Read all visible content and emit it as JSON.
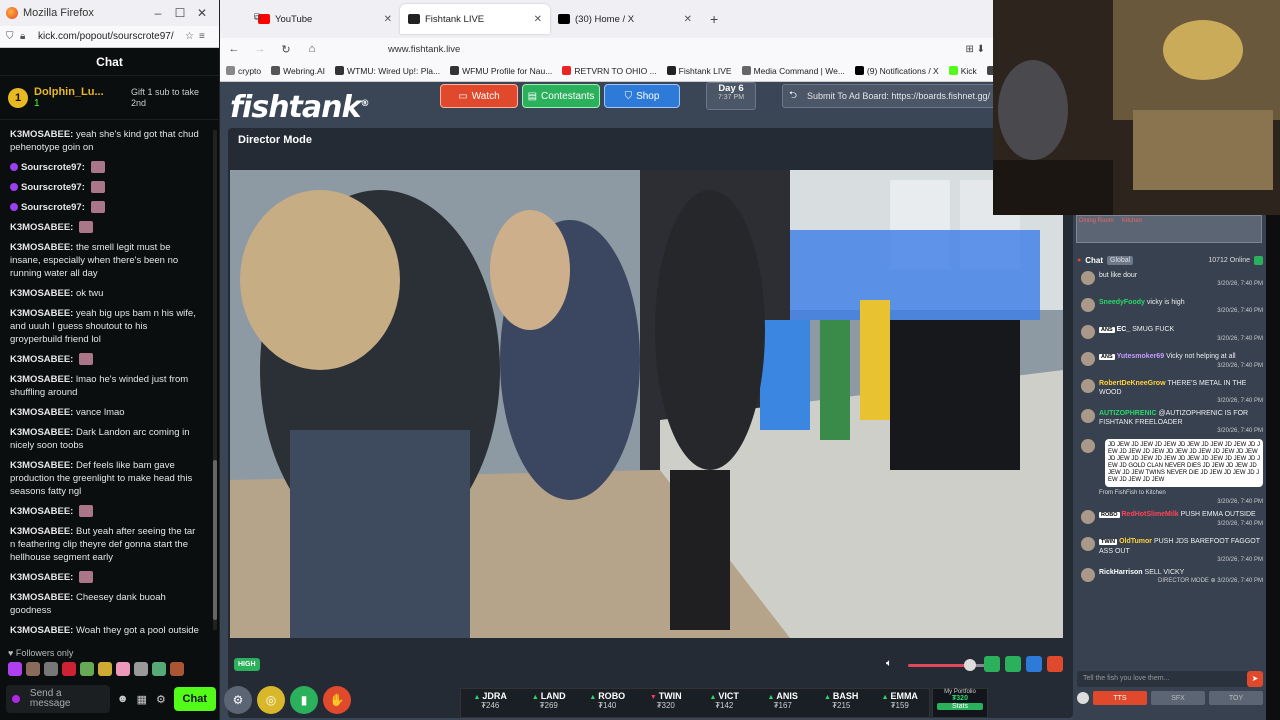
{
  "kick": {
    "window_title": "Mozilla Firefox",
    "url": "kick.com/popout/sourscrote97/",
    "chat_header": "Chat",
    "pinned": {
      "name": "Dolphin_Lu...",
      "count": "1",
      "gift_text": "Gift 1 sub to take 2nd"
    },
    "messages": [
      {
        "user": "K3MOSABEE:",
        "text": "yeah she's kind got that chud pehenotype goin on"
      },
      {
        "user": "Sourscrote97:",
        "text": "",
        "emote": true,
        "badge": true
      },
      {
        "user": "Sourscrote97:",
        "text": "",
        "emote": true,
        "badge": true
      },
      {
        "user": "Sourscrote97:",
        "text": "",
        "emote": true,
        "badge": true
      },
      {
        "user": "K3MOSABEE:",
        "text": "",
        "emote": true
      },
      {
        "user": "K3MOSABEE:",
        "text": "the smell legit must be insane, especially when there's been no running water all day"
      },
      {
        "user": "K3MOSABEE:",
        "text": "ok twu"
      },
      {
        "user": "K3MOSABEE:",
        "text": "yeah big ups bam n his wife, and uuuh I guess shoutout to his groyperbuild friend lol"
      },
      {
        "user": "K3MOSABEE:",
        "text": "",
        "emote": true
      },
      {
        "user": "K3MOSABEE:",
        "text": "lmao he's winded just from shuffling around"
      },
      {
        "user": "K3MOSABEE:",
        "text": "vance lmao"
      },
      {
        "user": "K3MOSABEE:",
        "text": "Dark Landon arc coming in nicely soon toobs"
      },
      {
        "user": "K3MOSABEE:",
        "text": "Def feels like bam gave production the greenlight to make head this seasons fatty ngl"
      },
      {
        "user": "K3MOSABEE:",
        "text": "",
        "emote": true
      },
      {
        "user": "K3MOSABEE:",
        "text": "But yeah after seeing the tar n feathering clip theyre def gonna start the hellhouse segment early"
      },
      {
        "user": "K3MOSABEE:",
        "text": "",
        "emote": true
      },
      {
        "user": "K3MOSABEE:",
        "text": "Cheesey dank buoah goodness"
      },
      {
        "user": "K3MOSABEE:",
        "text": "Woah they got a pool outside"
      }
    ],
    "followers_only": "Followers only",
    "input_placeholder": "Send a message",
    "chat_button": "Chat"
  },
  "browser": {
    "tabs": [
      {
        "label": "YouTube",
        "color": "#ff0000",
        "active": false
      },
      {
        "label": "Fishtank LIVE",
        "color": "#222222",
        "active": true
      },
      {
        "label": "(30) Home / X",
        "color": "#000000",
        "active": false
      }
    ],
    "url": "www.fishtank.live",
    "bookmarks": [
      {
        "label": "crypto",
        "color": "#888888"
      },
      {
        "label": "Webring.AI",
        "color": "#555555"
      },
      {
        "label": "WTMU: Wired Up!: Pla...",
        "color": "#333333"
      },
      {
        "label": "WFMU Profile for Nau...",
        "color": "#333333"
      },
      {
        "label": "RETVRN TO OHIO ...",
        "color": "#ee2222"
      },
      {
        "label": "Fishtank LIVE",
        "color": "#222222"
      },
      {
        "label": "Media Command | We...",
        "color": "#666666"
      },
      {
        "label": "(9) Notifications / X",
        "color": "#000000"
      },
      {
        "label": "Kick",
        "color": "#53fc18"
      },
      {
        "label": "Remilia",
        "color": "#444444"
      }
    ]
  },
  "fishtank": {
    "logo": "fishtank",
    "nav": {
      "watch": "Watch",
      "contestants": "Contestants",
      "shop": "Shop"
    },
    "day": "Day 6",
    "time": "7:37 PM",
    "adboard": "Submit To Ad Board: https://boards.fishnet.gg/",
    "director_title": "Director Mode",
    "quality": "HIGH",
    "cams": [
      {
        "name": "JDRA",
        "dir": "up",
        "value": "₮246"
      },
      {
        "name": "LAND",
        "dir": "up",
        "value": "₮269"
      },
      {
        "name": "ROBO",
        "dir": "up",
        "value": "₮140"
      },
      {
        "name": "TWIN",
        "dir": "down",
        "value": "₮320"
      },
      {
        "name": "VICT",
        "dir": "up",
        "value": "₮142"
      },
      {
        "name": "ANIS",
        "dir": "up",
        "value": "₮167"
      },
      {
        "name": "BASH",
        "dir": "up",
        "value": "₮215"
      },
      {
        "name": "EMMA",
        "dir": "up",
        "value": "₮159"
      }
    ],
    "portfolio": {
      "label": "My Portfolio",
      "value": "₮320",
      "button": "Stats"
    }
  },
  "ftchat": {
    "minimap_labels": [
      "Dining Room",
      "Kitchen"
    ],
    "header": "Chat",
    "global": "Global",
    "online": "10712 Online",
    "messages": [
      {
        "tag": "",
        "user": "",
        "user_color": "#eeeeee",
        "text": "but like dour",
        "time": "3/20/26, 7:40 PM"
      },
      {
        "tag": "",
        "user": "SneedyFoody",
        "user_color": "#2bd86b",
        "text": "vicky is high",
        "time": "3/20/26, 7:40 PM"
      },
      {
        "tag": "ANS",
        "user": "EC_",
        "user_color": "#ffffff",
        "text": "SMUG FUCK",
        "time": "3/20/26, 7:40 PM"
      },
      {
        "tag": "ANS",
        "user": "Yutesmoker69",
        "user_color": "#c89bff",
        "text": "Vicky not helping at all",
        "time": "3/20/26, 7:40 PM"
      },
      {
        "tag": "",
        "user": "RobertDeKneeGrow",
        "user_color": "#ffd23b",
        "text": "THERE'S METAL IN THE WOOD",
        "time": "3/20/26, 7:40 PM"
      },
      {
        "tag": "",
        "user": "AUTIZOPHRENIC",
        "user_color": "#2bd86b",
        "text": "@AUTIZOPHRENIC IS FOR FISHTANK FREELOADER",
        "time": "3/20/26, 7:40 PM"
      }
    ],
    "bubble": "JD JEW JD JEW JD JEW JD JEW JD JEW JD JEW JD JEW JD JEW JD JEW JD JEW JD JEW JD JEW JD JEW JD JEW JD JEW JD JEW JD JEW JD JEW JD JEW JD JEW JD GOLD CLAN NEVER DIES JD JEW JD JEW JD JEW JD JEW TWINS NEVER DIE JD JEW JD JEW JD JEW JD JEW JD JEW",
    "bubble_from": "From FishFish to Kitchen",
    "bubble_time": "3/20/26, 7:40 PM",
    "messages2": [
      {
        "tag": "ROBO",
        "user": "RedHotSlimeMilk",
        "user_color": "#ff4455",
        "text": "PUSH EMMA OUTSIDE",
        "time": "3/20/26, 7:40 PM"
      },
      {
        "tag": "TWIN",
        "user": "OldTumor",
        "user_color": "#ffd23b",
        "text": "PUSH JDS BAREFOOT FAGGOT ASS OUT",
        "time": "3/20/26, 7:40 PM"
      },
      {
        "tag": "",
        "user": "RickHarrison",
        "user_color": "#ffffff",
        "text": "SELL VICKY",
        "time": "DIRECTOR MODE ⊕ 3/20/26, 7:40 PM"
      }
    ],
    "input_placeholder": "Tell the fish you love them...",
    "buttons": [
      "TTS",
      "SFX",
      "TOY"
    ]
  }
}
